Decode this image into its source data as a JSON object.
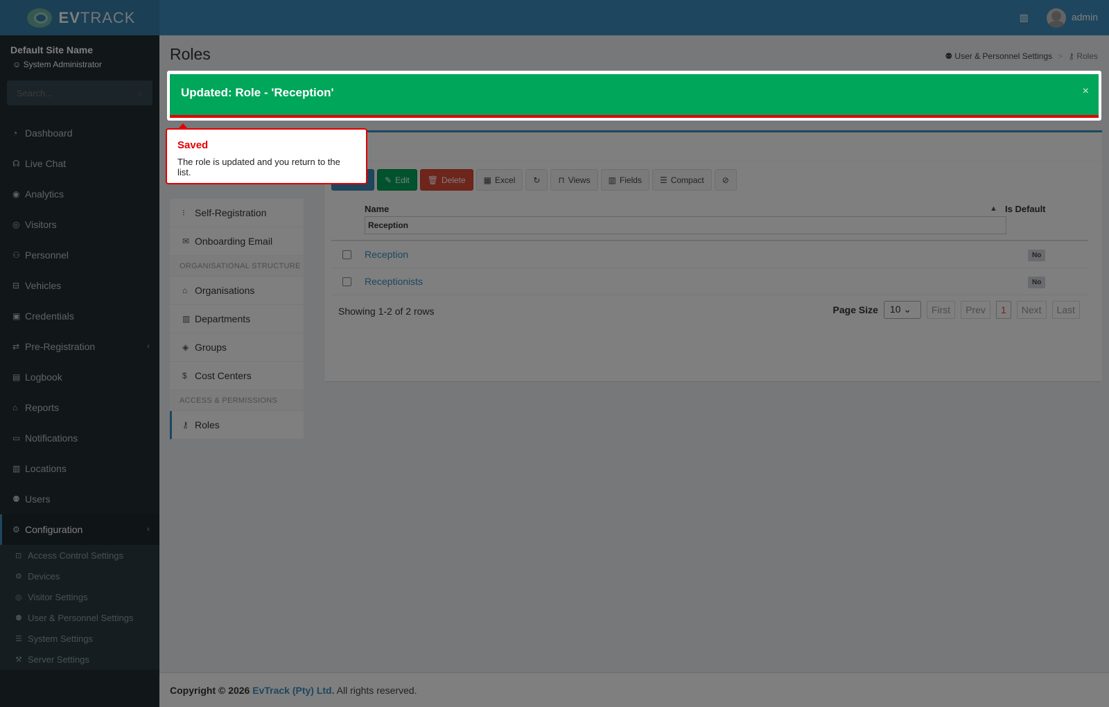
{
  "header": {
    "logo_bold": "EV",
    "logo_thin": "TRACK",
    "user": "admin"
  },
  "sidebar": {
    "site_name": "Default Site Name",
    "site_role": "System Administrator",
    "search_placeholder": "Search...",
    "items": [
      {
        "label": "Dashboard",
        "icon": "dashboard-icon"
      },
      {
        "label": "Live Chat",
        "icon": "headset-icon"
      },
      {
        "label": "Analytics",
        "icon": "target-icon"
      },
      {
        "label": "Visitors",
        "icon": "eye-icon"
      },
      {
        "label": "Personnel",
        "icon": "users-icon"
      },
      {
        "label": "Vehicles",
        "icon": "car-icon"
      },
      {
        "label": "Credentials",
        "icon": "id-card-icon"
      },
      {
        "label": "Pre-Registration",
        "icon": "arrows-icon"
      },
      {
        "label": "Logbook",
        "icon": "book-icon"
      },
      {
        "label": "Reports",
        "icon": "chart-icon"
      },
      {
        "label": "Notifications",
        "icon": "chat-icon"
      },
      {
        "label": "Locations",
        "icon": "map-icon"
      },
      {
        "label": "Users",
        "icon": "user-cog-icon"
      },
      {
        "label": "Configuration",
        "icon": "gear-icon"
      }
    ],
    "sub_items": [
      {
        "label": "Access Control Settings"
      },
      {
        "label": "Devices"
      },
      {
        "label": "Visitor Settings"
      },
      {
        "label": "User & Personnel Settings"
      },
      {
        "label": "System Settings"
      },
      {
        "label": "Server Settings"
      }
    ]
  },
  "page": {
    "title": "Roles",
    "breadcrumb": [
      "User & Personnel Settings",
      "Roles"
    ]
  },
  "alert": {
    "message": "Updated: Role - 'Reception'",
    "close": "×"
  },
  "tooltip": {
    "title": "Saved",
    "text": "The role is updated and you return to the list."
  },
  "sub_nav": {
    "items_top": [
      "Self-Registration",
      "Onboarding Email"
    ],
    "header_org": "ORGANISATIONAL STRUCTURE",
    "items_org": [
      "Organisations",
      "Departments",
      "Groups",
      "Cost Centers"
    ],
    "header_access": "ACCESS & PERMISSIONS",
    "items_access": [
      "Roles"
    ]
  },
  "toolbar": {
    "edit": "Edit",
    "delete": "Delete",
    "excel": "Excel",
    "views": "Views",
    "fields": "Fields",
    "compact": "Compact"
  },
  "grid": {
    "col_name": "Name",
    "col_default": "Is Default",
    "filter_value": "Reception",
    "rows": [
      {
        "name": "Reception",
        "is_default": "No"
      },
      {
        "name": "Receptionists",
        "is_default": "No"
      }
    ],
    "showing": "Showing 1-2 of 2 rows",
    "page_size_label": "Page Size",
    "page_size": "10",
    "first": "First",
    "prev": "Prev",
    "current_page": "1",
    "next": "Next",
    "last": "Last"
  },
  "footer": {
    "prefix": "Copyright © 2026",
    "company": "EvTrack (Pty) Ltd.",
    "suffix": "All rights reserved."
  }
}
